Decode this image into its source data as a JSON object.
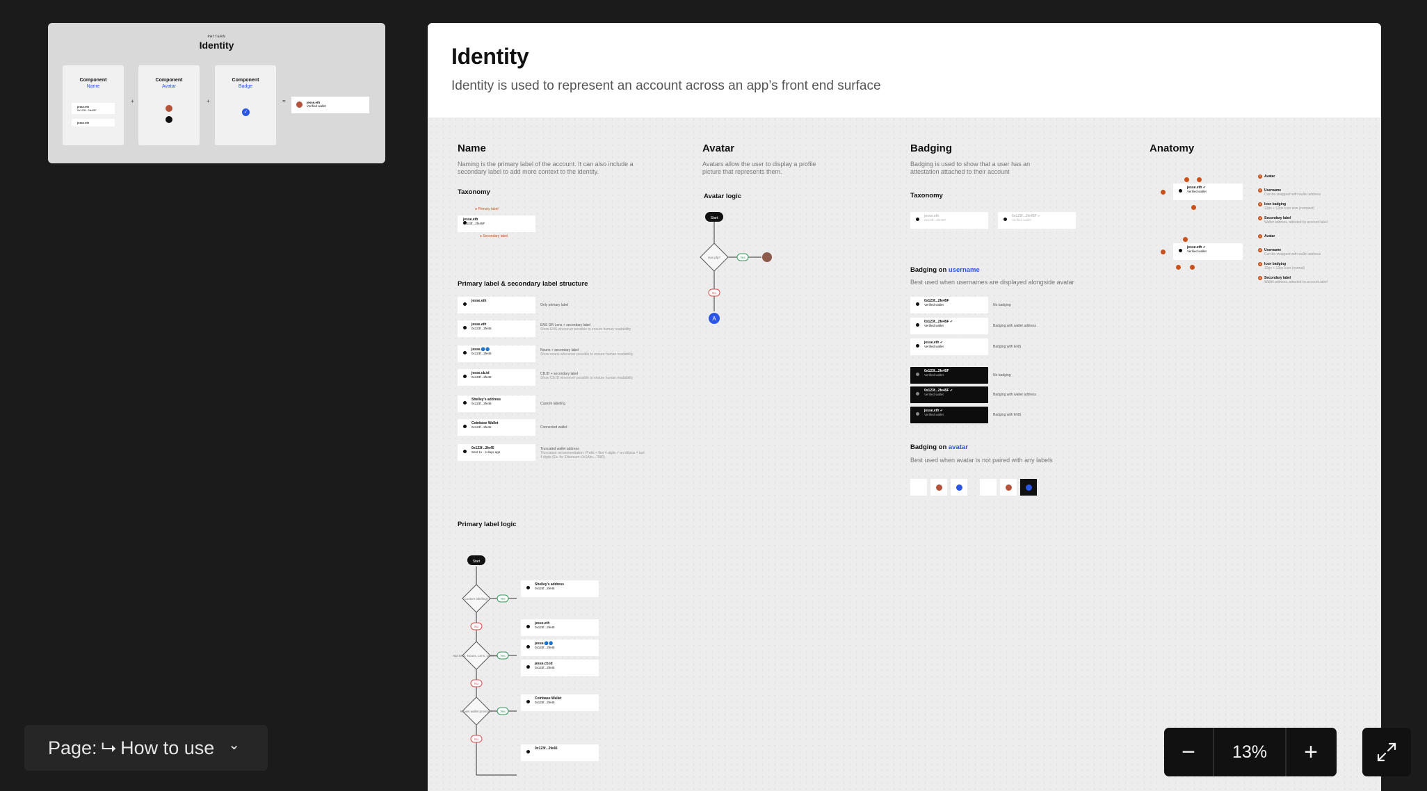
{
  "thumbnail": {
    "pattern_label": "PATTERN",
    "title": "Identity",
    "components": [
      {
        "label": "Component",
        "name": "Name"
      },
      {
        "label": "Component",
        "name": "Avatar"
      },
      {
        "label": "Component",
        "name": "Badge"
      }
    ],
    "operators": [
      "+",
      "+",
      "="
    ],
    "name_samples": [
      {
        "primary": "jesse.eth",
        "secondary": "0x123f...2fe45F"
      },
      {
        "primary": "jesse.eth",
        "secondary": ""
      }
    ],
    "result": {
      "primary": "jesse.eth",
      "secondary": "Verified wallet"
    }
  },
  "header": {
    "title": "Identity",
    "subtitle": "Identity is used to represent an account across an app’s front end surface"
  },
  "name_section": {
    "title": "Name",
    "description_1": "Naming is the primary label of the account. It can also include a",
    "description_2": "secondary label to add more context to the identity.",
    "taxonomy": "Taxonomy",
    "primary_label_tag": "Primary label",
    "secondary_label_tag": "Secondary label",
    "taxonomy_sample": {
      "primary": "jesse.eth",
      "secondary": "0x123f...2fe45F"
    },
    "structure_title": "Primary label & secondary label structure",
    "rows": [
      {
        "primary": "jesse.eth",
        "secondary": "",
        "desc": "Only primary label",
        "note": ""
      },
      {
        "primary": "jesse.eth",
        "secondary": "0x123f...2fe45",
        "desc": "ENS OR Lens + secondary label",
        "note": "Show ENS whenever possible to ensure human readability"
      },
      {
        "primary": "jesse.🔵🔵",
        "secondary": "0x123f...2fe45",
        "desc": "Nouns + secondary label",
        "note": "Show nouns whenever possible to ensure human readability"
      },
      {
        "primary": "jesse.cb.id",
        "secondary": "0x123f...2fe45",
        "desc": "CB.ID + secondary label",
        "note": "Show CB.ID whenever possible to ensure human readability"
      },
      {
        "primary": "Shelley's address",
        "secondary": "0x123f...2fe45",
        "desc": "Custom labeling",
        "note": ""
      },
      {
        "primary": "Coinbase Wallet",
        "secondary": "0x123f...2fe45",
        "desc": "Connected wallet",
        "note": ""
      },
      {
        "primary": "0x123f...2fe45",
        "secondary": "Sent 1x · 4 days ago",
        "desc": "Truncated wallet address",
        "note": "Truncation recommendation: Prefix + first 4 digits + an ellipsis + last 4 digits (Ex. for Ethereum: 0x1Abc...7890)"
      }
    ],
    "logic_title": "Primary label logic",
    "logic_start": "Start",
    "logic_q1": "Custom labeling?",
    "logic_q2": "Has ENS, Nouns, Lens, or CB.ID?",
    "logic_q3": "Known wallet provider?",
    "yes": "Yes",
    "no": "No",
    "logic_results": [
      {
        "primary": "Shelley's address",
        "secondary": "0x123f...2fe45"
      },
      {
        "primary": "jesse.eth",
        "secondary": "0x123f...2fe45"
      },
      {
        "primary": "jesse.🔵🔵",
        "secondary": "0x123f...2fe45"
      },
      {
        "primary": "jesse.cb.id",
        "secondary": "0x123f...2fe45"
      },
      {
        "primary": "Coinbase Wallet",
        "secondary": "0x123f...2fe45"
      },
      {
        "primary": "0x123f...2fe45",
        "secondary": ""
      }
    ]
  },
  "avatar_section": {
    "title": "Avatar",
    "description_1": "Avatars allow the user to display a profile",
    "description_2": "picture that represents them.",
    "logic_title": "Avatar logic",
    "start": "Start",
    "question": "Has pfp?",
    "yes": "Yes",
    "no": "No",
    "fallback": "A"
  },
  "badging_section": {
    "title": "Badging",
    "description_1": "Badging is used to show that a user has an",
    "description_2": "attestation attached to their account",
    "taxonomy": "Taxonomy",
    "taxonomy_samples": [
      {
        "primary": "jesse.eth",
        "secondary": "0x123f...2fe45F"
      },
      {
        "primary": "0x123f...2fe45F ✔",
        "secondary": "Verified wallet"
      }
    ],
    "username_title_prefix": "Badging on ",
    "username_title_link": "username",
    "username_desc": "Best used when usernames are displayed alongside avatar",
    "light_rows": [
      {
        "primary": "0x123f...2fe45F",
        "secondary": "Verified wallet",
        "desc": "No badging"
      },
      {
        "primary": "0x123f...2fe45F ✔",
        "secondary": "Verified wallet",
        "desc": "Badging with wallet address"
      },
      {
        "primary": "jesse.eth ✔",
        "secondary": "Verified wallet",
        "desc": "Badging with ENS"
      }
    ],
    "dark_rows": [
      {
        "primary": "0x123f...2fe45F",
        "secondary": "Verified wallet",
        "desc": "No badging"
      },
      {
        "primary": "0x123f...2fe45F ✔",
        "secondary": "Verified wallet",
        "desc": "Badging with wallet address"
      },
      {
        "primary": "jesse.eth ✔",
        "secondary": "Verified wallet",
        "desc": "Badging with ENS"
      }
    ],
    "avatar_title_prefix": "Badging on ",
    "avatar_title_link": "avatar",
    "avatar_desc": "Best used when avatar is not paired with any labels"
  },
  "anatomy_section": {
    "title": "Anatomy",
    "sample": {
      "primary": "jesse.eth ✔",
      "secondary": "Verified wallet"
    },
    "legend": [
      {
        "n": "1",
        "label": "Avatar",
        "note": ""
      },
      {
        "n": "2",
        "label": "Username",
        "note": "Can be swapped with wallet address"
      },
      {
        "n": "3",
        "label": "Icon badging",
        "note": "12px + 12px Icon size (compact)"
      },
      {
        "n": "4",
        "label": "Secondary label",
        "note": "Wallet address, attested by account label"
      }
    ],
    "legend2": [
      {
        "n": "1",
        "label": "Avatar",
        "note": ""
      },
      {
        "n": "2",
        "label": "Username",
        "note": "Can be swapped with wallet address"
      },
      {
        "n": "3",
        "label": "Icon badging",
        "note": "12px + 12px Icon (normal)"
      },
      {
        "n": "4",
        "label": "Secondary label",
        "note": "Wallet address, attested by account label"
      }
    ]
  },
  "page_selector": {
    "prefix": "Page:",
    "arrow": "⮡",
    "page": "How to use",
    "chevron": "⌄"
  },
  "zoom": {
    "minus": "−",
    "value": "13%",
    "plus": "+"
  },
  "colors": {
    "background": "#1b1b1c",
    "canvas": "#ededed",
    "accent_blue": "#2a55e5",
    "orange": "#c9521c",
    "green": "#2e9a5a",
    "red": "#d94b4b"
  }
}
